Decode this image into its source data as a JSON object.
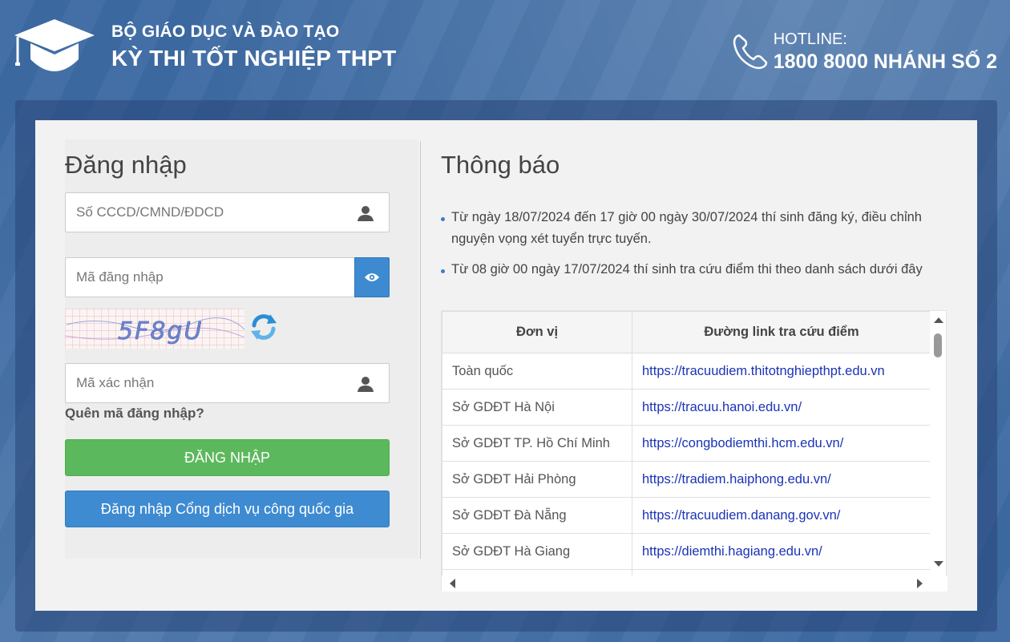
{
  "header": {
    "ministry": "BỘ GIÁO DỤC VÀ ĐÀO TẠO",
    "exam_name": "KỲ THI TỐT NGHIỆP THPT",
    "hotline_label": "HOTLINE:",
    "hotline_number": "1800 8000 NHÁNH SỐ 2",
    "logo_icon": "graduation-cap-icon",
    "phone_icon": "phone-icon"
  },
  "login": {
    "title": "Đăng nhập",
    "id_placeholder": "Số CCCD/CMND/ĐDCD",
    "password_placeholder": "Mã đăng nhập",
    "captcha_text": "5F8gU",
    "captcha_placeholder": "Mã xác nhận",
    "forgot_label": "Quên mã đăng nhập?",
    "login_button": "ĐĂNG NHẬP",
    "gov_login_button": "Đăng nhập Cổng dịch vụ công quốc gia"
  },
  "notice": {
    "title": "Thông báo",
    "items": [
      "Từ ngày 18/07/2024 đến 17 giờ 00 ngày 30/07/2024 thí sinh đăng ký, điều chỉnh nguyện vọng xét tuyển trực tuyến.",
      "Từ 08 giờ 00 ngày 17/07/2024 thí sinh tra cứu điểm thi theo danh sách dưới đây"
    ],
    "table": {
      "headers": [
        "Đơn vị",
        "Đường link tra cứu điểm"
      ],
      "rows": [
        {
          "unit": "Toàn quốc",
          "link": "https://tracuudiem.thitotnghiepthpt.edu.vn"
        },
        {
          "unit": "Sở GDĐT Hà Nội",
          "link": "https://tracuu.hanoi.edu.vn/"
        },
        {
          "unit": "Sở GDĐT TP. Hồ Chí Minh",
          "link": "https://congbodiemthi.hcm.edu.vn/"
        },
        {
          "unit": "Sở GDĐT Hải Phòng",
          "link": "https://tradiem.haiphong.edu.vn/"
        },
        {
          "unit": "Sở GDĐT Đà Nẵng",
          "link": "https://tracuudiem.danang.gov.vn/"
        },
        {
          "unit": "Sở GDĐT Hà Giang",
          "link": "https://diemthi.hagiang.edu.vn/"
        },
        {
          "unit": "",
          "link": ""
        }
      ]
    }
  },
  "colors": {
    "background": "#3c6aa3",
    "login_button": "#5cb85c",
    "gov_button": "#3e8bd2",
    "link": "#1a33b8"
  }
}
